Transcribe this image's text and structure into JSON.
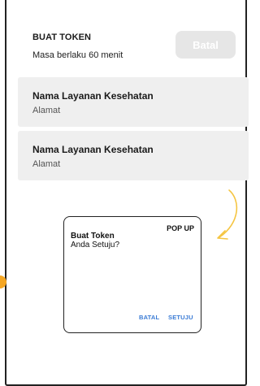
{
  "header": {
    "title": "BUAT TOKEN",
    "subtitle": "Masa berlaku 60 menit",
    "cancel_label": "Batal"
  },
  "services": [
    {
      "name": "Nama Layanan Kesehatan",
      "address": "Alamat"
    },
    {
      "name": "Nama Layanan Kesehatan",
      "address": "Alamat"
    }
  ],
  "popup": {
    "tag": "POP UP",
    "title": "Buat Token",
    "question": "Anda Setuju?",
    "cancel_label": "BATAL",
    "confirm_label": "SETUJU"
  },
  "colors": {
    "accent_arrow": "#f5c542",
    "marker": "#f5a623",
    "link_blue": "#3a7bd5"
  }
}
